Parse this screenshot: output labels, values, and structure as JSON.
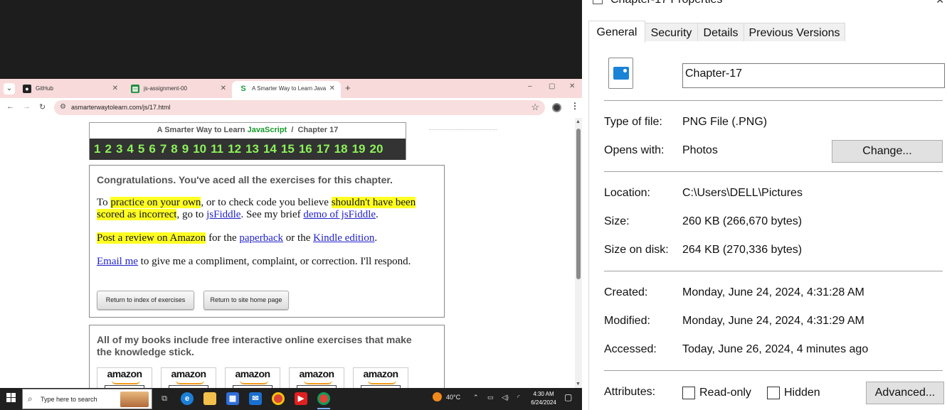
{
  "browser": {
    "tabs": [
      {
        "title": "GitHub",
        "icon": "github-icon"
      },
      {
        "title": "js-assignment-00",
        "icon": "sheets-icon"
      },
      {
        "title": "A Smarter Way to Learn JavaScri",
        "icon": "site-s-icon"
      }
    ],
    "new_tab": "+",
    "url": "asmarterwaytolearn.com/js/17.html",
    "window_controls": [
      "–",
      "▢",
      "✕"
    ]
  },
  "page": {
    "header_prefix": "A Smarter Way to Learn ",
    "header_js": "JavaScript",
    "header_suffix": "  /  Chapter 17",
    "chapters": [
      "1",
      "2",
      "3",
      "4",
      "5",
      "6",
      "7",
      "8",
      "9",
      "10",
      "11",
      "12",
      "13",
      "14",
      "15",
      "16",
      "17",
      "18",
      "19",
      "20"
    ],
    "congrats_heading": "Congratulations. You've aced all the exercises for this chapter.",
    "p1": {
      "t1": "To ",
      "h1": "practice on your own",
      "t2": ", or to check code you believe ",
      "h2": "shouldn't have been scored as incorrect",
      "t3": ", go to ",
      "l1": "jsFiddle",
      "t4": ". See my brief ",
      "l2": "demo of jsFiddle",
      "t5": "."
    },
    "p2": {
      "h1": "Post a review on Amazon",
      "t1": " for the ",
      "l1": "paperback",
      "t2": " or the ",
      "l2": "Kindle edition",
      "t3": "."
    },
    "p3": {
      "l1": "Email me",
      "t1": " to give me a compliment, complaint, or correction. I'll respond."
    },
    "btn_index": "Return to index of exercises",
    "btn_home": "Return to site home page",
    "books_heading": "All of my books include free interactive online exercises that make the knowledge stick.",
    "amazon_label": "amazon"
  },
  "taskbar": {
    "search_placeholder": "Type here to search",
    "weather": "40°C",
    "time": "4:30 AM",
    "date": "6/24/2024"
  },
  "properties": {
    "title": "Chapter-17 Properties",
    "tabs": [
      "General",
      "Security",
      "Details",
      "Previous Versions"
    ],
    "file_name": "Chapter-17",
    "type_label": "Type of file:",
    "type_value": "PNG File (.PNG)",
    "opens_label": "Opens with:",
    "opens_value": "Photos",
    "change_button": "Change...",
    "location_label": "Location:",
    "location_value": "C:\\Users\\DELL\\Pictures",
    "size_label": "Size:",
    "size_value": "260 KB (266,670 bytes)",
    "size_disk_label": "Size on disk:",
    "size_disk_value": "264 KB (270,336 bytes)",
    "created_label": "Created:",
    "created_value": "Monday, June 24, 2024, 4:31:28 AM",
    "modified_label": "Modified:",
    "modified_value": "Monday, June 24, 2024, 4:31:29 AM",
    "accessed_label": "Accessed:",
    "accessed_value": "Today, June 26, 2024, 4 minutes ago",
    "attributes_label": "Attributes:",
    "readonly_label": "Read-only",
    "hidden_label": "Hidden",
    "advanced_button": "Advanced..."
  }
}
